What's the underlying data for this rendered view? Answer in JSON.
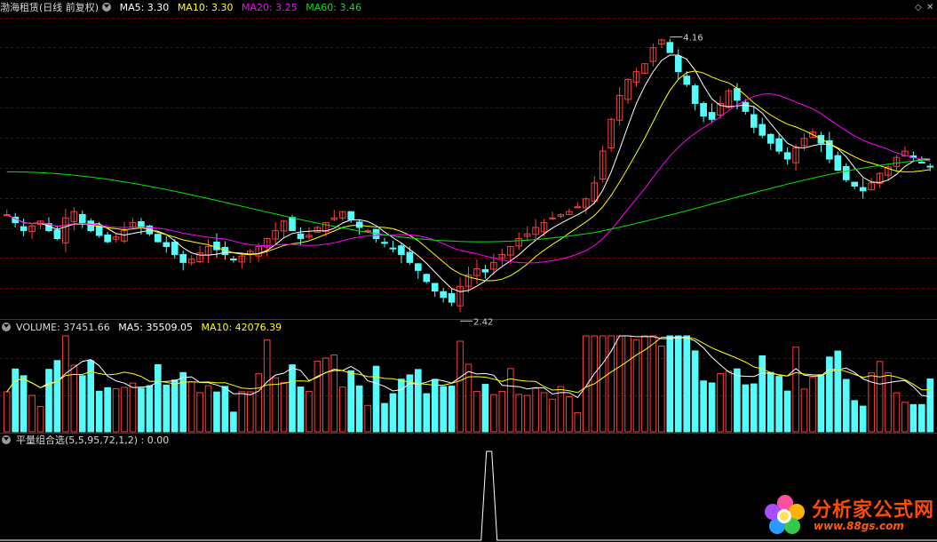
{
  "main": {
    "title": "渤海租赁(日线 前复权)",
    "ma5": "MA5: 3.30",
    "ma10": "MA10: 3.30",
    "ma20": "MA20: 3.25",
    "ma60": "MA60: 3.46",
    "high_label": "4.16",
    "low_label": "2.42"
  },
  "volume": {
    "title": "VOLUME: 37451.66",
    "ma5": "MA5: 35509.05",
    "ma10": "MA10: 42076.39"
  },
  "indicator": {
    "title": "平量组合选(5,5,95,72,1,2) : 0.00"
  },
  "watermark": {
    "text": "分析家公式网",
    "url": "www.88gs.com"
  },
  "colors": {
    "up": "#ff3c3c",
    "down": "#54fcfc",
    "ma5": "#ffffff",
    "ma10": "#ffff00",
    "ma20": "#ff00ff",
    "ma60": "#00e600",
    "grid": "#7a0000"
  },
  "chart_data": [
    {
      "type": "candlestick",
      "title": "渤海租赁(日线 前复权)",
      "ylim": [
        2.35,
        4.25
      ],
      "annotations": [
        {
          "label": "4.16",
          "y": 4.16
        },
        {
          "label": "2.42",
          "y": 2.42
        }
      ],
      "close_approx": [
        3.0,
        2.95,
        2.9,
        2.93,
        2.96,
        2.9,
        2.85,
        2.98,
        3.02,
        2.95,
        2.9,
        2.87,
        2.83,
        2.86,
        2.9,
        2.95,
        2.92,
        2.88,
        2.83,
        2.8,
        2.75,
        2.7,
        2.72,
        2.76,
        2.8,
        2.78,
        2.75,
        2.72,
        2.74,
        2.77,
        2.8,
        2.85,
        2.9,
        2.96,
        2.9,
        2.85,
        2.87,
        2.92,
        2.95,
        2.98,
        3.02,
        2.97,
        2.92,
        2.9,
        2.85,
        2.82,
        2.79,
        2.75,
        2.7,
        2.65,
        2.58,
        2.52,
        2.48,
        2.45,
        2.55,
        2.62,
        2.66,
        2.64,
        2.7,
        2.75,
        2.8,
        2.85,
        2.88,
        2.92,
        2.95,
        2.98,
        3.0,
        3.02,
        3.05,
        3.1,
        3.2,
        3.4,
        3.6,
        3.75,
        3.85,
        3.9,
        3.95,
        4.05,
        4.1,
        4.02,
        3.9,
        3.82,
        3.7,
        3.62,
        3.6,
        3.7,
        3.78,
        3.72,
        3.65,
        3.55,
        3.5,
        3.45,
        3.4,
        3.35,
        3.42,
        3.48,
        3.52,
        3.45,
        3.35,
        3.28,
        3.22,
        3.18,
        3.15,
        3.2,
        3.26,
        3.3,
        3.36,
        3.4,
        3.36,
        3.33,
        3.3
      ]
    },
    {
      "type": "bar",
      "title": "VOLUME: 37451.66",
      "series": [
        {
          "name": "MA5",
          "value": 35509.05
        },
        {
          "name": "MA10",
          "value": 42076.39
        }
      ]
    },
    {
      "type": "line",
      "title": "平量组合选(5,5,95,72,1,2) : 0.00",
      "values_desc": "0 everywhere except a single spike near bar 58"
    }
  ]
}
